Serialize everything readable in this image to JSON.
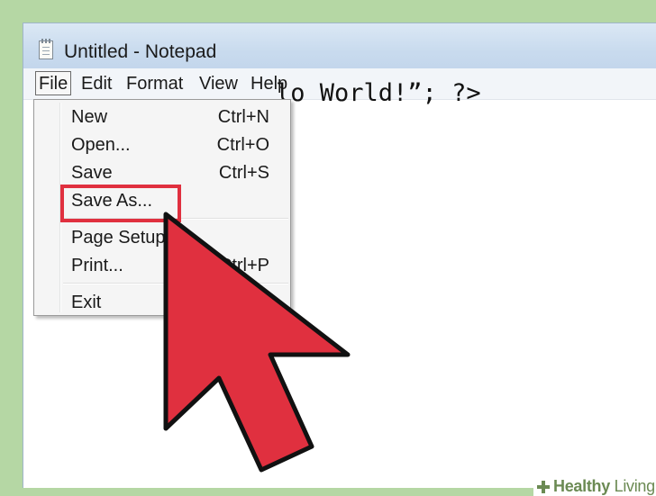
{
  "window": {
    "title": "Untitled - Notepad",
    "icon": "notepad-icon"
  },
  "menubar": {
    "items": [
      "File",
      "Edit",
      "Format",
      "View",
      "Help"
    ],
    "active": "File"
  },
  "editor": {
    "visible_text": "lo World!”; ?>"
  },
  "file_menu": {
    "items": [
      {
        "label": "New",
        "shortcut": "Ctrl+N"
      },
      {
        "label": "Open...",
        "shortcut": "Ctrl+O"
      },
      {
        "label": "Save",
        "shortcut": "Ctrl+S"
      },
      {
        "label": "Save As...",
        "shortcut": ""
      },
      {
        "label": "Page Setup...",
        "shortcut": ""
      },
      {
        "label": "Print...",
        "shortcut": "Ctrl+P"
      },
      {
        "label": "Exit",
        "shortcut": ""
      }
    ],
    "highlighted_item": "Save As..."
  },
  "annotation": {
    "highlight_color": "#e0303f",
    "cursor_color": "#e0303f"
  },
  "watermark": {
    "brand_bold": "Healthy",
    "brand_light": " Living",
    "icon": "plus-cross-icon",
    "color": "#6b8a53"
  }
}
